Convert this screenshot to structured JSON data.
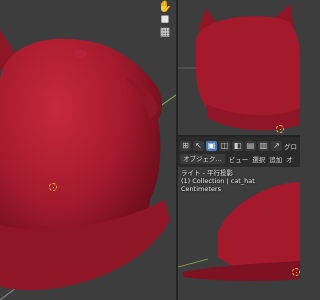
{
  "viewport_main": {
    "nav_icons": [
      "hand-icon",
      "camera-icon",
      "grid-icon"
    ]
  },
  "viewport_bottom": {
    "header": {
      "row1_icons": [
        "view-icon",
        "cursor-icon",
        "select-box-icon",
        "select-circle-icon",
        "select-lasso-icon",
        "select-extend-icon",
        "select-subtract-icon",
        "select-invert-icon",
        "select-intersect-icon",
        "global-icon"
      ],
      "truncated_label": "グロ",
      "mode_label": "オブジェク...",
      "menu_items": [
        "ビュー",
        "選択",
        "追加",
        "オ"
      ]
    },
    "overlay": {
      "view_name": "ライト - 平行投影",
      "collection_info": "(1) Collection | cat_hat",
      "units": "Centimeters"
    }
  },
  "colors": {
    "hat": "#a41a2c",
    "hat_shadow": "#6e0e1c",
    "hat_highlight": "#c8283d",
    "background": "#3d3d3d",
    "header": "#2b2b2b",
    "origin": "#f5b24a",
    "selection_active": "#4a78b8"
  }
}
